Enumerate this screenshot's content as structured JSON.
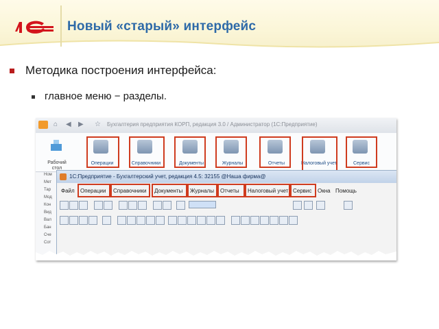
{
  "header": {
    "title": "Новый «старый» интерфейс",
    "logo_text": "1С"
  },
  "bullets": {
    "level1": "Методика построения интерфейса:",
    "level2": "главное меню − разделы."
  },
  "old_ui": {
    "window_title": "Бухгалтерия предприятия КОРП, редакция 3.0 / Администратор  (1С:Предприятие)",
    "workspace_label": [
      "Рабочий",
      "стол"
    ],
    "sections": [
      "Операции",
      "Справочники",
      "Документы",
      "Журналы",
      "Отчеты",
      "Налоговый учет",
      "Сервис"
    ],
    "side_items": [
      "Ном",
      "Мет",
      "Тар",
      "Мод",
      "Кон",
      "Вид",
      "Вал",
      "Бан",
      "Сче",
      "Сот"
    ]
  },
  "new_ui": {
    "window_title": "1С:Предприятие - Бухгалтерский учет, редакция 4.5: 32155 @Наша фирма@",
    "menu": [
      "Файл",
      "Операции",
      "Справочники",
      "Документы",
      "Журналы",
      "Отчеты",
      "Налоговый учет",
      "Сервис",
      "Окна",
      "Помощь"
    ]
  },
  "colors": {
    "highlight": "#cf3b1e",
    "title": "#2e6aa8",
    "accent": "#b91d1d"
  }
}
